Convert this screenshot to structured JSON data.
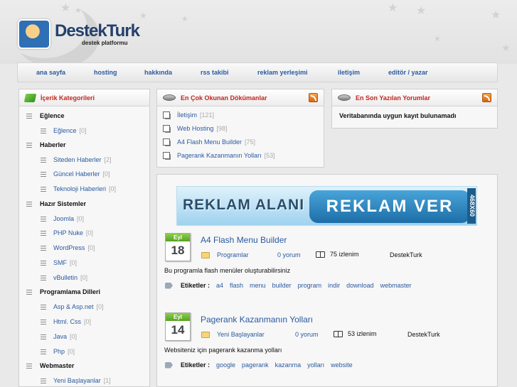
{
  "brand": {
    "title": "DestekTurk",
    "subtitle": "destek platformu"
  },
  "nav": {
    "items": [
      {
        "label": "ana sayfa"
      },
      {
        "label": "hosting"
      },
      {
        "label": "hakkında"
      },
      {
        "label": "rss takibi"
      },
      {
        "label": "reklam yerleşimi"
      },
      {
        "label": "iletişim"
      },
      {
        "label": "editör / yazar"
      }
    ]
  },
  "categories": {
    "title": "İçerik Kategorileri",
    "groups": [
      {
        "name": "Eğlence",
        "items": [
          {
            "label": "Eğlence",
            "count": "[0]"
          }
        ]
      },
      {
        "name": "Haberler",
        "items": [
          {
            "label": "Siteden Haberler",
            "count": "[2]"
          },
          {
            "label": "Güncel Haberler",
            "count": "[0]"
          },
          {
            "label": "Teknoloji Haberleri",
            "count": "[0]"
          }
        ]
      },
      {
        "name": "Hazır Sistemler",
        "items": [
          {
            "label": "Joomla",
            "count": "[0]"
          },
          {
            "label": "PHP Nuke",
            "count": "[0]"
          },
          {
            "label": "WordPress",
            "count": "[0]"
          },
          {
            "label": "SMF",
            "count": "[0]"
          },
          {
            "label": "vBulletin",
            "count": "[0]"
          }
        ]
      },
      {
        "name": "Programlama Dilleri",
        "items": [
          {
            "label": "Asp & Asp.net",
            "count": "[0]"
          },
          {
            "label": "Html. Css",
            "count": "[0]"
          },
          {
            "label": "Java",
            "count": "[0]"
          },
          {
            "label": "Php",
            "count": "[0]"
          }
        ]
      },
      {
        "name": "Webmaster",
        "items": [
          {
            "label": "Yeni Başlayanlar",
            "count": "[1]"
          }
        ]
      }
    ]
  },
  "most_read": {
    "title": "En Çok Okunan Dökümanlar",
    "items": [
      {
        "label": "İletişim",
        "count": "[121]"
      },
      {
        "label": "Web Hosting",
        "count": "[98]"
      },
      {
        "label": "A4 Flash Menu Builder",
        "count": "[75]"
      },
      {
        "label": "Pagerank Kazanmanın Yolları",
        "count": "[53]"
      }
    ]
  },
  "latest_comments": {
    "title": "En Son Yazılan Yorumlar",
    "empty_text": "Veritabanında uygun kayıt bulunamadı"
  },
  "banner": {
    "left_text": "REKLAM ALANI",
    "right_text": "REKLAM VER",
    "size_text": "468X60"
  },
  "posts": [
    {
      "month": "Eyl",
      "day": "18",
      "title": "A4 Flash Menu Builder",
      "category": "Programlar",
      "comments": "0 yorum",
      "views": "75 izlenim",
      "author": "DestekTurk",
      "description": "Bu programla flash menüler oluşturabilirsiniz",
      "tags_label": "Etiketler  :",
      "tags": [
        "a4",
        "flash",
        "menu",
        "builder",
        "program",
        "indir",
        "download",
        "webmaster"
      ]
    },
    {
      "month": "Eyl",
      "day": "14",
      "title": "Pagerank Kazanmanın Yolları",
      "category": "Yeni Başlayanlar",
      "comments": "0 yorum",
      "views": "53 izlenim",
      "author": "DestekTurk",
      "description": "Websiteniz için pagerank kazanma yolları",
      "tags_label": "Etiketler  :",
      "tags": [
        "google",
        "pagerank",
        "kazanma",
        "yolları",
        "website"
      ]
    }
  ]
}
